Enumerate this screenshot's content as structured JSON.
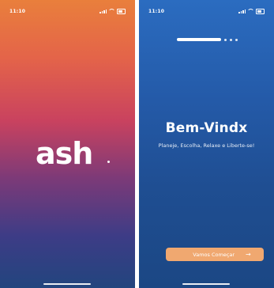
{
  "splash": {
    "status_time": "11:10",
    "logo_text": "ash"
  },
  "onboarding": {
    "status_time": "11:10",
    "title": "Bem-Vindx",
    "subtitle": "Planeje, Escolha, Relaxe e Liberte-se!",
    "cta_label": "Vamos Começar",
    "cta_arrow": "→"
  }
}
